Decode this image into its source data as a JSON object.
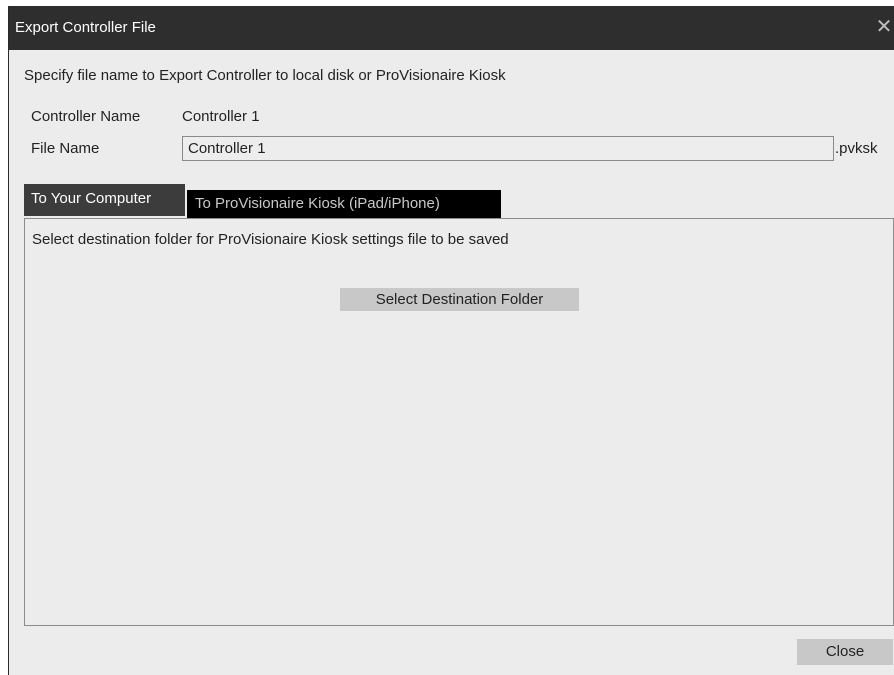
{
  "window": {
    "title": "Export Controller File",
    "close_glyph": "✕"
  },
  "instruction": "Specify file name to Export Controller to local disk or ProVisionaire Kiosk",
  "form": {
    "controller_name_label": "Controller Name",
    "controller_name_value": "Controller 1",
    "file_name_label": "File Name",
    "file_name_value": "Controller 1",
    "file_extension": ".pvksk"
  },
  "tabs": [
    {
      "label": "To Your Computer",
      "active": true
    },
    {
      "label": "To ProVisionaire Kiosk (iPad/iPhone)",
      "active": false
    }
  ],
  "panel": {
    "description": "Select destination folder for ProVisionaire Kiosk settings file to be saved",
    "button_label": "Select Destination Folder"
  },
  "footer": {
    "close_label": "Close"
  },
  "colors": {
    "titlebar": "#2e2e2e",
    "dialog_bg": "#ececec",
    "active_tab": "#3c3c3c",
    "inactive_tab": "#000000",
    "button": "#c8c8c8"
  },
  "icons": {
    "close": "close-icon"
  }
}
